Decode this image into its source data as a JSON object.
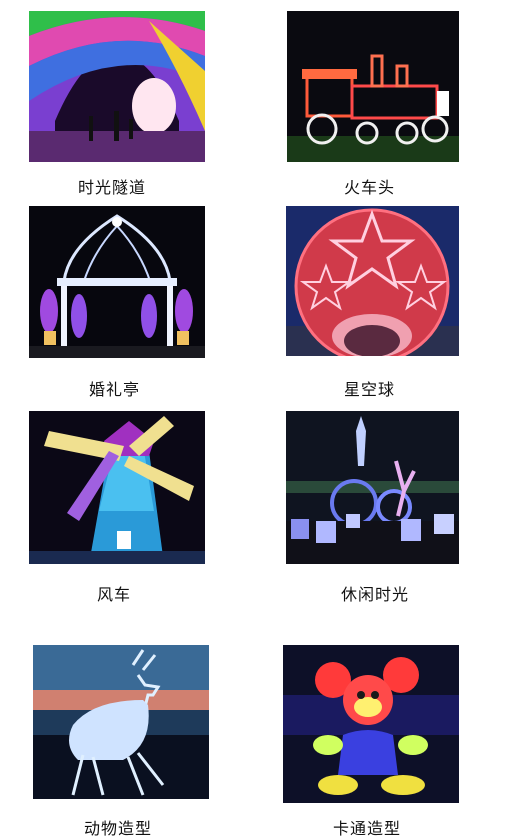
{
  "items": [
    {
      "caption": "时光隧道"
    },
    {
      "caption": "火车头"
    },
    {
      "caption": "婚礼亭"
    },
    {
      "caption": "星空球"
    },
    {
      "caption": "风车"
    },
    {
      "caption": "休闲时光"
    },
    {
      "caption": "动物造型"
    },
    {
      "caption": "卡通造型"
    }
  ]
}
